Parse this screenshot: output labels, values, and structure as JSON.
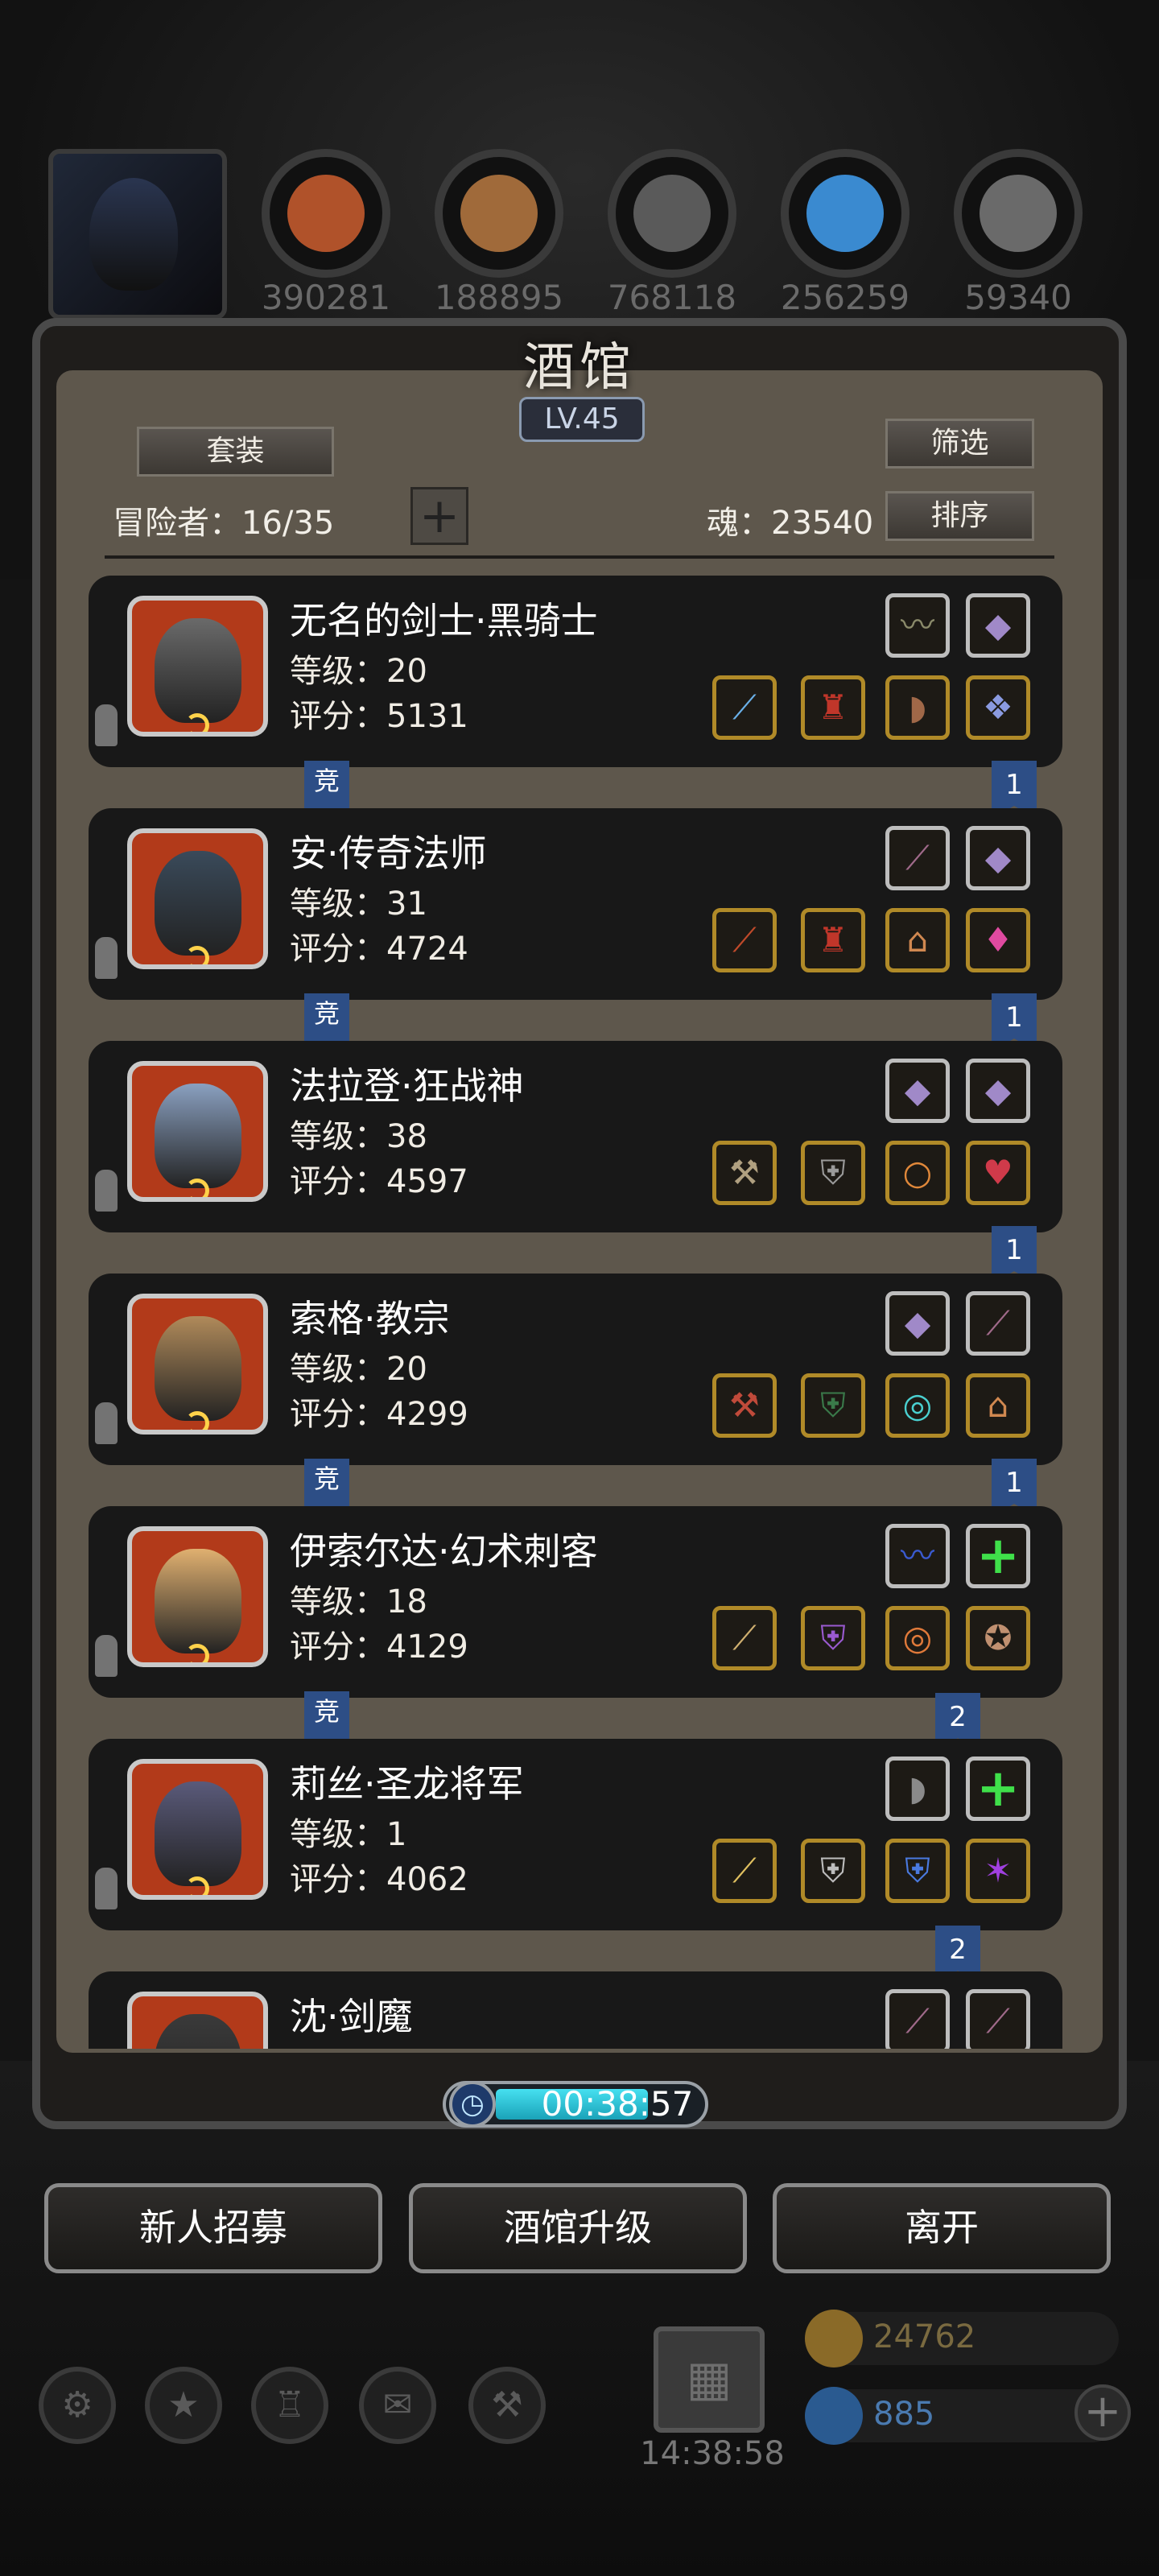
{
  "resources": [
    {
      "icon": "ore-icon",
      "value": "390281",
      "color": "#b0522a"
    },
    {
      "icon": "wood-icon",
      "value": "188895",
      "color": "#a06a3a"
    },
    {
      "icon": "stone-icon",
      "value": "768118",
      "color": "#5a5a5a"
    },
    {
      "icon": "crystal-icon",
      "value": "256259",
      "color": "#3a8ad0"
    },
    {
      "icon": "iron-icon",
      "value": "59340",
      "color": "#6a6a6a"
    }
  ],
  "panel": {
    "title": "酒馆",
    "level": "LV.45",
    "set_button": "套装",
    "filter_button": "筛选",
    "sort_button": "排序",
    "adventurers_label": "冒险者：16/35",
    "plus_label": "+",
    "soul_label": "魂：23540"
  },
  "heroes": [
    {
      "name": "无名的剑士·黑骑士",
      "level": "等级：20",
      "score": "评分：5131",
      "tag": "竞",
      "num": "1",
      "top": [
        {
          "g": "〰",
          "c": "#8a8a6a"
        },
        {
          "g": "◆",
          "c": "#a089c8"
        }
      ],
      "bottom": [
        {
          "g": "⟋",
          "c": "#6ab0e8"
        },
        {
          "g": "♜",
          "c": "#c0362a"
        },
        {
          "g": "◗",
          "c": "#a06848"
        },
        {
          "g": "❖",
          "c": "#8a9ae0"
        }
      ]
    },
    {
      "name": "安·传奇法师",
      "level": "等级：31",
      "score": "评分：4724",
      "tag": "竞",
      "num": "1",
      "top": [
        {
          "g": "⟋",
          "c": "#a06a8a"
        },
        {
          "g": "◆",
          "c": "#a089c8"
        }
      ],
      "bottom": [
        {
          "g": "⟋",
          "c": "#c04a2a"
        },
        {
          "g": "♜",
          "c": "#c0362a"
        },
        {
          "g": "⌂",
          "c": "#d08850"
        },
        {
          "g": "♦",
          "c": "#e04aa0"
        }
      ]
    },
    {
      "name": "法拉登·狂战神",
      "level": "等级：38",
      "score": "评分：4597",
      "tag": "",
      "num": "1",
      "top": [
        {
          "g": "◆",
          "c": "#a089c8"
        },
        {
          "g": "◆",
          "c": "#a089c8"
        }
      ],
      "bottom": [
        {
          "g": "⚒",
          "c": "#b0a080"
        },
        {
          "g": "⛨",
          "c": "#9a9a9a"
        },
        {
          "g": "○",
          "c": "#e0883a"
        },
        {
          "g": "♥",
          "c": "#d03a4a"
        }
      ]
    },
    {
      "name": "索格·教宗",
      "level": "等级：20",
      "score": "评分：4299",
      "tag": "竞",
      "num": "1",
      "top": [
        {
          "g": "◆",
          "c": "#a089c8"
        },
        {
          "g": "⟋",
          "c": "#a06a8a"
        }
      ],
      "bottom": [
        {
          "g": "⚒",
          "c": "#c04a3a"
        },
        {
          "g": "⛨",
          "c": "#3a7a4a"
        },
        {
          "g": "◎",
          "c": "#4ad0d0"
        },
        {
          "g": "⌂",
          "c": "#d08850"
        }
      ]
    },
    {
      "name": "伊索尔达·幻术刺客",
      "level": "等级：18",
      "score": "评分：4129",
      "tag": "竞",
      "num": "2",
      "top": [
        {
          "g": "〰",
          "c": "#3a5ad0"
        },
        {
          "g": "+",
          "c": "#3fe04a",
          "plus": true
        }
      ],
      "bottom": [
        {
          "g": "⟋",
          "c": "#d0b070"
        },
        {
          "g": "⛨",
          "c": "#9a5ad0"
        },
        {
          "g": "◎",
          "c": "#e07a3a"
        },
        {
          "g": "✪",
          "c": "#c09070"
        }
      ]
    },
    {
      "name": "莉丝·圣龙将军",
      "level": "等级：1",
      "score": "评分：4062",
      "tag": "",
      "num": "2",
      "top": [
        {
          "g": "◗",
          "c": "#8a8a8a"
        },
        {
          "g": "+",
          "c": "#3fe04a",
          "plus": true
        }
      ],
      "bottom": [
        {
          "g": "⟋",
          "c": "#e0c060"
        },
        {
          "g": "⛨",
          "c": "#bdbdbd"
        },
        {
          "g": "⛨",
          "c": "#4a7ae0"
        },
        {
          "g": "✶",
          "c": "#a040e0"
        }
      ]
    },
    {
      "name": "沈·剑魔",
      "level": "",
      "score": "",
      "tag": "",
      "num": "",
      "top": [
        {
          "g": "⟋",
          "c": "#a06a8a"
        },
        {
          "g": "⟋",
          "c": "#a06a8a"
        }
      ],
      "bottom": []
    }
  ],
  "portrait_colors": [
    "#6a6a6a",
    "#3a4a5a",
    "#8aa0c0",
    "#b08a5a",
    "#e0b070",
    "#5a5a7a",
    "#3a3a3a"
  ],
  "timer": {
    "text": "00:38:57",
    "progress": 0.64
  },
  "buttons": {
    "recruit": "新人招募",
    "upgrade": "酒馆升级",
    "leave": "离开"
  },
  "bottom_bar": {
    "gift_time": "14:38:58",
    "gold": "24762",
    "gems": "885",
    "icons": [
      "settings-icon",
      "star-icon",
      "armory-icon",
      "mail-icon",
      "forge-icon"
    ]
  }
}
